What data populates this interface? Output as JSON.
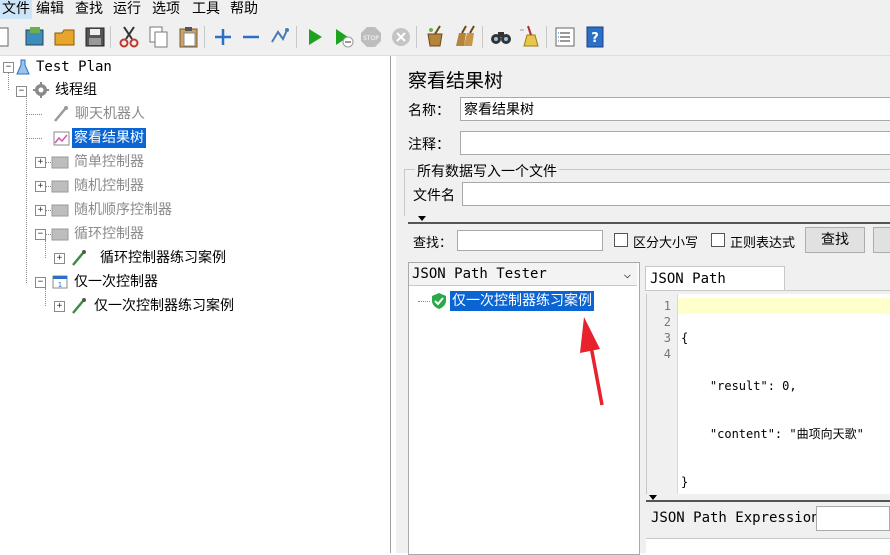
{
  "menu": {
    "file": "文件",
    "edit": "编辑",
    "search": "查找",
    "run": "运行",
    "options": "选项",
    "tools": "工具",
    "help": "帮助"
  },
  "tree": {
    "root": "Test Plan",
    "thread_group": "线程组",
    "chatbot": "聊天机器人",
    "view_results_tree": "察看结果树",
    "simple_controller": "简单控制器",
    "random_controller": "随机控制器",
    "random_order_controller": "随机顺序控制器",
    "loop_controller": "循环控制器",
    "loop_case": "循环控制器练习案例",
    "once_controller": "仅一次控制器",
    "once_case": "仅一次控制器练习案例"
  },
  "panel": {
    "title": "察看结果树",
    "name_label": "名称：",
    "name_value": "察看结果树",
    "comment_label": "注释：",
    "comment_value": "",
    "file_section": "所有数据写入一个文件",
    "filename_label": "文件名",
    "filename_value": ""
  },
  "search": {
    "label": "查找：",
    "value": "",
    "case_sensitive": "区分大小写",
    "regex": "正则表达式",
    "button": "查找"
  },
  "renderer": {
    "selected": "JSON Path Tester",
    "result_item": "仅一次控制器练习案例"
  },
  "tester": {
    "tab": "JSON Path Tester",
    "line_numbers": [
      "1",
      "2",
      "3",
      "4"
    ],
    "code_lines": [
      "{",
      "    \"result\": 0,",
      "    \"content\": \"曲项向天歌\"",
      "}"
    ],
    "expression_label": "JSON Path Expression",
    "expression_value": ""
  },
  "colors": {
    "selection": "#0a64d2",
    "annotation_arrow": "#e8222c",
    "success_shield": "#2aa84a",
    "run_green": "#1fa31f",
    "code_highlight": "#ffffcc"
  }
}
